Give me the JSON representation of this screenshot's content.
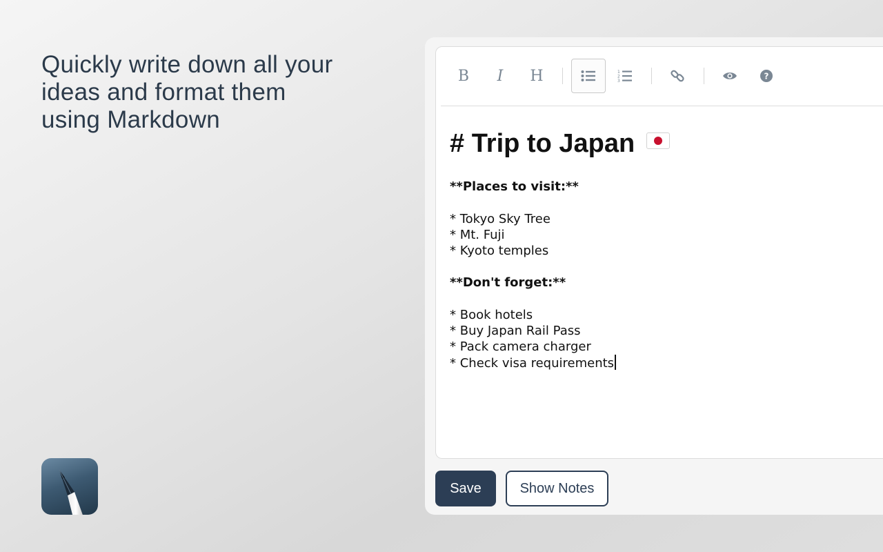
{
  "headline": {
    "lines": [
      "Quickly write down all your",
      "ideas and format them",
      "using Markdown"
    ]
  },
  "app_icon": {
    "name": "pen-icon"
  },
  "toolbar": {
    "bold_label": "B",
    "italic_label": "I",
    "heading_label": "H",
    "buttons": [
      {
        "name": "bold",
        "icon": "B"
      },
      {
        "name": "italic",
        "icon": "I"
      },
      {
        "name": "heading",
        "icon": "H"
      },
      {
        "name": "unordered-list",
        "icon": "bullet-list-icon",
        "active": true
      },
      {
        "name": "ordered-list",
        "icon": "numbered-list-icon"
      },
      {
        "name": "link",
        "icon": "link-icon"
      },
      {
        "name": "preview",
        "icon": "eye-icon"
      },
      {
        "name": "help",
        "icon": "question-icon"
      }
    ]
  },
  "editor": {
    "heading": "# Trip to Japan",
    "heading_emoji": "japan-flag",
    "section1_title": "**Places to visit:**",
    "section1_items": [
      "* Tokyo Sky Tree",
      "* Mt. Fuji",
      "* Kyoto temples"
    ],
    "section2_title": "**Don't forget:**",
    "section2_items": [
      "* Book hotels",
      "* Buy Japan Rail Pass",
      "* Pack camera charger",
      "* Check visa requirements"
    ]
  },
  "actions": {
    "save_label": "Save",
    "show_notes_label": "Show Notes"
  },
  "colors": {
    "primary": "#2c3e55",
    "toolbar_icon": "#7a8794",
    "flag_red": "#c8102e"
  }
}
